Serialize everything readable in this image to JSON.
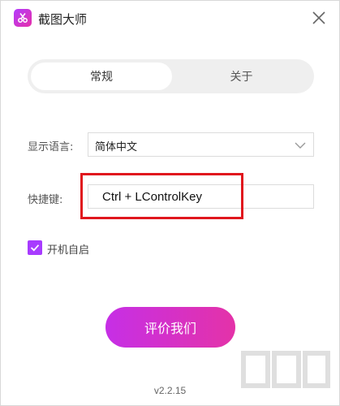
{
  "app": {
    "title": "截图大师",
    "logo_icon": "scissors-icon"
  },
  "tabs": [
    {
      "label": "常规",
      "active": true
    },
    {
      "label": "关于",
      "active": false
    }
  ],
  "settings": {
    "language_label": "显示语言:",
    "language_value": "简体中文",
    "hotkey_label": "快捷键:",
    "hotkey_value": "Ctrl + LControlKey",
    "autostart_label": "开机自启",
    "autostart_checked": true
  },
  "actions": {
    "rate_label": "评价我们"
  },
  "footer": {
    "version": "v2.2.15"
  },
  "colors": {
    "accent": "#a83bff",
    "button_gradient_start": "#c62fe6",
    "button_gradient_end": "#e432a8",
    "highlight": "#e0161d"
  }
}
